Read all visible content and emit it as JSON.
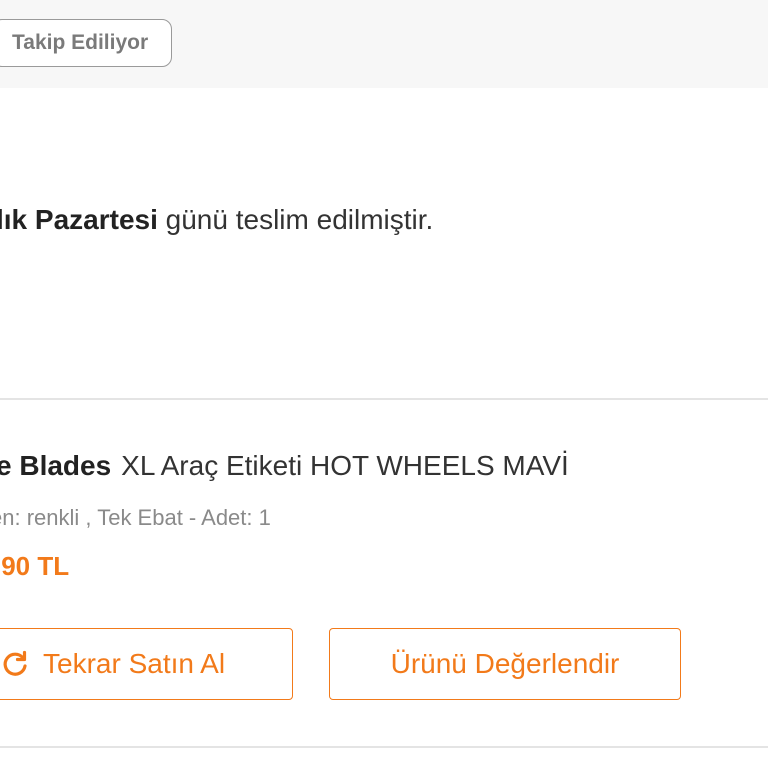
{
  "header": {
    "follow_chip_label": "Takip Ediliyor"
  },
  "delivery": {
    "day_bold": "lık Pazartesi",
    "rest_text": " günü teslim edilmiştir."
  },
  "product": {
    "brand": "e Blades",
    "name": "XL Araç Etiketi HOT WHEELS MAVİ",
    "variant": "en: renkli , Tek Ebat - Adet: 1",
    "price": ",90 TL"
  },
  "actions": {
    "rebuy_label": "Tekrar Satın Al",
    "rate_label": "Ürünü Değerlendir"
  },
  "colors": {
    "accent": "#f27a1a",
    "muted_text": "#8a8a8a",
    "divider": "#e4e4e4",
    "top_band": "#f7f7f7"
  },
  "icons": {
    "rebuy_icon": "refresh-icon"
  }
}
